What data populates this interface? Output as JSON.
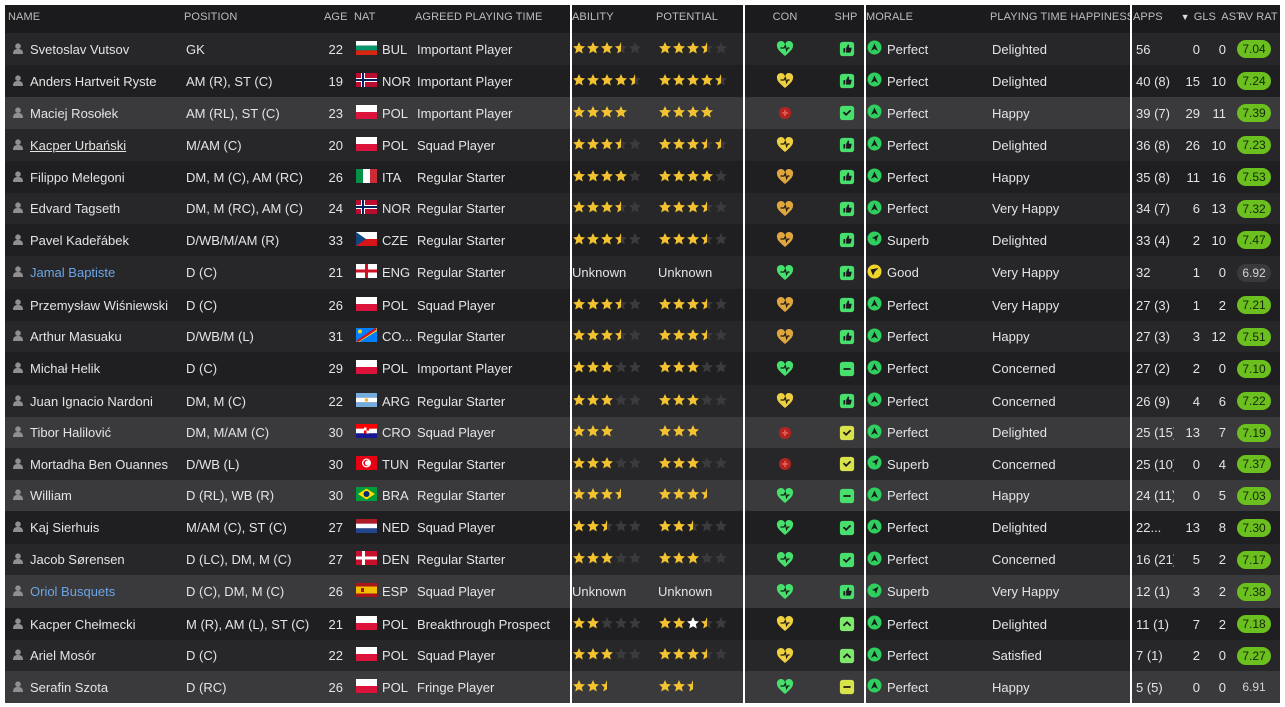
{
  "headers": {
    "name": "NAME",
    "position": "POSITION",
    "age": "AGE",
    "nat": "NAT",
    "playing_time": "AGREED PLAYING TIME",
    "ability": "ABILITY",
    "potential": "POTENTIAL",
    "con": "CON",
    "shp": "SHP",
    "morale": "MORALE",
    "happiness": "PLAYING TIME HAPPINESS",
    "apps": "APPS",
    "gls": "GLS",
    "ast": "AST",
    "avrat": "AV RAT"
  },
  "sort": {
    "column": "apps",
    "direction": "descending",
    "icon": "triangle-down-icon"
  },
  "colors": {
    "background": "#1b1b1d",
    "row_alt": "#27272a",
    "row_selected": "#3a3a3d",
    "star": "#f2c230",
    "heart_green": "#4be070",
    "heart_yellow": "#f2c744",
    "rating_good": "#6bbf1e",
    "morale_green": "#2ecf5d",
    "morale_yellow": "#f0d528",
    "link_blue": "#6aa6e6"
  },
  "players": [
    {
      "name": "Svetoslav Vutsov",
      "position": "GK",
      "age": "22",
      "nat": "BUL",
      "flag": "BUL",
      "playing_time": "Important Player",
      "ability": 3.5,
      "potential": 3.5,
      "ability_text": "",
      "potential_text": "",
      "con": "heart-green",
      "shp": "thumbs-up",
      "morale_icon": "up-green",
      "morale": "Perfect",
      "happiness": "Delighted",
      "apps": "56",
      "gls": "0",
      "ast": "0",
      "avrat": "7.04",
      "rat_class": "good",
      "name_style": "normal"
    },
    {
      "name": "Anders Hartveit Ryste",
      "position": "AM (R), ST (C)",
      "age": "19",
      "nat": "NOR",
      "flag": "NOR",
      "playing_time": "Important Player",
      "ability": 4.5,
      "potential": 4.5,
      "ability_text": "",
      "potential_text": "",
      "con": "heart-yellow",
      "shp": "thumbs-up",
      "morale_icon": "up-green",
      "morale": "Perfect",
      "happiness": "Delighted",
      "apps": "40 (8)",
      "gls": "15",
      "ast": "10",
      "avrat": "7.24",
      "rat_class": "good",
      "name_style": "normal"
    },
    {
      "name": "Maciej Rosołek",
      "position": "AM (RL), ST (C)",
      "age": "23",
      "nat": "POL",
      "flag": "POL",
      "playing_time": "Important Player",
      "ability": 4,
      "potential": 4,
      "ability_text": "",
      "potential_text": "",
      "con": "injury-red",
      "shp": "check",
      "morale_icon": "up-green",
      "morale": "Perfect",
      "happiness": "Happy",
      "apps": "39 (7)",
      "gls": "29",
      "ast": "11",
      "avrat": "7.39",
      "rat_class": "good",
      "name_style": "normal"
    },
    {
      "name": "Kacper Urbański",
      "position": "M/AM (C)",
      "age": "20",
      "nat": "POL",
      "flag": "POL",
      "playing_time": "Squad Player",
      "ability": 3.5,
      "potential": 4.5,
      "ability_text": "",
      "potential_text": "",
      "con": "heart-yellow",
      "shp": "thumbs-up",
      "morale_icon": "up-green",
      "morale": "Perfect",
      "happiness": "Delighted",
      "apps": "36 (8)",
      "gls": "26",
      "ast": "10",
      "avrat": "7.23",
      "rat_class": "good",
      "name_style": "underline"
    },
    {
      "name": "Filippo Melegoni",
      "position": "DM, M (C), AM (RC)",
      "age": "26",
      "nat": "ITA",
      "flag": "ITA",
      "playing_time": "Regular Starter",
      "ability": 4,
      "potential": 4,
      "ability_text": "",
      "potential_text": "",
      "con": "heart-orange",
      "shp": "thumbs-up",
      "morale_icon": "up-green",
      "morale": "Perfect",
      "happiness": "Happy",
      "apps": "35 (8)",
      "gls": "11",
      "ast": "16",
      "avrat": "7.53",
      "rat_class": "good",
      "name_style": "normal"
    },
    {
      "name": "Edvard Tagseth",
      "position": "DM, M (RC), AM (C)",
      "age": "24",
      "nat": "NOR",
      "flag": "NOR",
      "playing_time": "Regular Starter",
      "ability": 3.5,
      "potential": 3.5,
      "ability_text": "",
      "potential_text": "",
      "con": "heart-orange",
      "shp": "thumbs-up",
      "morale_icon": "up-green",
      "morale": "Perfect",
      "happiness": "Very Happy",
      "apps": "34 (7)",
      "gls": "6",
      "ast": "13",
      "avrat": "7.32",
      "rat_class": "good",
      "name_style": "normal"
    },
    {
      "name": "Pavel Kadeřábek",
      "position": "D/WB/M/AM (R)",
      "age": "33",
      "nat": "CZE",
      "flag": "CZE",
      "playing_time": "Regular Starter",
      "ability": 3.5,
      "potential": 3.5,
      "ability_text": "",
      "potential_text": "",
      "con": "heart-orange",
      "shp": "thumbs-up",
      "morale_icon": "diag-green",
      "morale": "Superb",
      "happiness": "Delighted",
      "apps": "33 (4)",
      "gls": "2",
      "ast": "10",
      "avrat": "7.47",
      "rat_class": "good",
      "name_style": "normal"
    },
    {
      "name": "Jamal Baptiste",
      "position": "D (C)",
      "age": "21",
      "nat": "ENG",
      "flag": "ENG",
      "playing_time": "Regular Starter",
      "ability": 0,
      "potential": 0,
      "ability_text": "Unknown",
      "potential_text": "Unknown",
      "con": "heart-green",
      "shp": "thumbs-up",
      "morale_icon": "diag-yellow",
      "morale": "Good",
      "happiness": "Very Happy",
      "apps": "32",
      "gls": "1",
      "ast": "0",
      "avrat": "6.92",
      "rat_class": "avg",
      "name_style": "link"
    },
    {
      "name": "Przemysław Wiśniewski",
      "position": "D (C)",
      "age": "26",
      "nat": "POL",
      "flag": "POL",
      "playing_time": "Squad Player",
      "ability": 3.5,
      "potential": 3.5,
      "ability_text": "",
      "potential_text": "",
      "con": "heart-orange",
      "shp": "thumbs-up",
      "morale_icon": "up-green",
      "morale": "Perfect",
      "happiness": "Very Happy",
      "apps": "27 (3)",
      "gls": "1",
      "ast": "2",
      "avrat": "7.21",
      "rat_class": "good",
      "name_style": "normal"
    },
    {
      "name": "Arthur Masuaku",
      "position": "D/WB/M (L)",
      "age": "31",
      "nat": "CO...",
      "flag": "COD",
      "playing_time": "Regular Starter",
      "ability": 3.5,
      "potential": 3.5,
      "ability_text": "",
      "potential_text": "",
      "con": "heart-orange",
      "shp": "thumbs-up",
      "morale_icon": "up-green",
      "morale": "Perfect",
      "happiness": "Happy",
      "apps": "27 (3)",
      "gls": "3",
      "ast": "12",
      "avrat": "7.51",
      "rat_class": "good",
      "name_style": "normal"
    },
    {
      "name": "Michał Helik",
      "position": "D (C)",
      "age": "29",
      "nat": "POL",
      "flag": "POL",
      "playing_time": "Important Player",
      "ability": 3,
      "potential": 3,
      "ability_text": "",
      "potential_text": "",
      "con": "heart-green",
      "shp": "minus",
      "morale_icon": "up-green",
      "morale": "Perfect",
      "happiness": "Concerned",
      "apps": "27 (2)",
      "gls": "2",
      "ast": "0",
      "avrat": "7.10",
      "rat_class": "good",
      "name_style": "normal"
    },
    {
      "name": "Juan Ignacio Nardoni",
      "position": "DM, M (C)",
      "age": "22",
      "nat": "ARG",
      "flag": "ARG",
      "playing_time": "Regular Starter",
      "ability": 3,
      "potential": 3,
      "ability_text": "",
      "potential_text": "",
      "con": "heart-yellow",
      "shp": "thumbs-up",
      "morale_icon": "up-green",
      "morale": "Perfect",
      "happiness": "Concerned",
      "apps": "26 (9)",
      "gls": "4",
      "ast": "6",
      "avrat": "7.22",
      "rat_class": "good",
      "name_style": "normal"
    },
    {
      "name": "Tibor Halilović",
      "position": "DM, M/AM (C)",
      "age": "30",
      "nat": "CRO",
      "flag": "CRO",
      "playing_time": "Squad Player",
      "ability": 3,
      "potential": 3,
      "ability_text": "",
      "potential_text": "",
      "con": "injury-red",
      "shp": "check-yellow",
      "morale_icon": "up-green",
      "morale": "Perfect",
      "happiness": "Delighted",
      "apps": "25 (15)",
      "gls": "13",
      "ast": "7",
      "avrat": "7.19",
      "rat_class": "good",
      "name_style": "normal"
    },
    {
      "name": "Mortadha Ben Ouannes",
      "position": "D/WB (L)",
      "age": "30",
      "nat": "TUN",
      "flag": "TUN",
      "playing_time": "Regular Starter",
      "ability": 3,
      "potential": 3,
      "ability_text": "",
      "potential_text": "",
      "con": "injury-red",
      "shp": "check-yellow",
      "morale_icon": "diag-green",
      "morale": "Superb",
      "happiness": "Concerned",
      "apps": "25 (10)",
      "gls": "0",
      "ast": "4",
      "avrat": "7.37",
      "rat_class": "good",
      "name_style": "normal"
    },
    {
      "name": "William",
      "position": "D (RL), WB (R)",
      "age": "30",
      "nat": "BRA",
      "flag": "BRA",
      "playing_time": "Regular Starter",
      "ability": 3.5,
      "potential": 3.5,
      "ability_text": "",
      "potential_text": "",
      "con": "heart-green",
      "shp": "minus",
      "morale_icon": "up-green",
      "morale": "Perfect",
      "happiness": "Happy",
      "apps": "24 (11)",
      "gls": "0",
      "ast": "5",
      "avrat": "7.03",
      "rat_class": "good",
      "name_style": "normal"
    },
    {
      "name": "Kaj Sierhuis",
      "position": "M/AM (C), ST (C)",
      "age": "27",
      "nat": "NED",
      "flag": "NED",
      "playing_time": "Squad Player",
      "ability": 2.5,
      "potential": 3,
      "ability_text": "",
      "potential_text": "",
      "con": "heart-green",
      "shp": "check",
      "morale_icon": "up-green",
      "morale": "Perfect",
      "happiness": "Delighted",
      "apps": "22...",
      "gls": "13",
      "ast": "8",
      "avrat": "7.30",
      "rat_class": "good",
      "name_style": "normal"
    },
    {
      "name": "Jacob Sørensen",
      "position": "D (LC), DM, M (C)",
      "age": "27",
      "nat": "DEN",
      "flag": "DEN",
      "playing_time": "Regular Starter",
      "ability": 3,
      "potential": 3,
      "ability_text": "",
      "potential_text": "",
      "con": "heart-green",
      "shp": "check",
      "morale_icon": "up-green",
      "morale": "Perfect",
      "happiness": "Concerned",
      "apps": "16 (21)",
      "gls": "5",
      "ast": "2",
      "avrat": "7.17",
      "rat_class": "good",
      "name_style": "normal"
    },
    {
      "name": "Oriol Busquets",
      "position": "D (C), DM, M (C)",
      "age": "26",
      "nat": "ESP",
      "flag": "ESP",
      "playing_time": "Squad Player",
      "ability": 0,
      "potential": 0,
      "ability_text": "Unknown",
      "potential_text": "Unknown",
      "con": "heart-green",
      "shp": "thumbs-up",
      "morale_icon": "diag-green",
      "morale": "Superb",
      "happiness": "Very Happy",
      "apps": "12 (1)",
      "gls": "3",
      "ast": "2",
      "avrat": "7.38",
      "rat_class": "good",
      "name_style": "link"
    },
    {
      "name": "Kacper Chełmecki",
      "position": "M (R), AM (L), ST (C)",
      "age": "21",
      "nat": "POL",
      "flag": "POL",
      "playing_time": "Breakthrough Prospect",
      "ability": 2,
      "potential": 3.5,
      "ability_text": "",
      "potential_text": "",
      "con": "heart-yellow",
      "shp": "up-arrow",
      "morale_icon": "up-green",
      "morale": "Perfect",
      "happiness": "Delighted",
      "apps": "11 (1)",
      "gls": "7",
      "ast": "2",
      "avrat": "7.18",
      "rat_class": "good",
      "name_style": "normal"
    },
    {
      "name": "Ariel Mosór",
      "position": "D (C)",
      "age": "22",
      "nat": "POL",
      "flag": "POL",
      "playing_time": "Squad Player",
      "ability": 3,
      "potential": 3.5,
      "ability_text": "",
      "potential_text": "",
      "con": "heart-yellow",
      "shp": "up-arrow",
      "morale_icon": "up-green",
      "morale": "Perfect",
      "happiness": "Satisfied",
      "apps": "7 (1)",
      "gls": "2",
      "ast": "0",
      "avrat": "7.27",
      "rat_class": "good",
      "name_style": "normal"
    },
    {
      "name": "Serafin Szota",
      "position": "D (RC)",
      "age": "26",
      "nat": "POL",
      "flag": "POL",
      "playing_time": "Fringe Player",
      "ability": 2.5,
      "potential": 2.5,
      "ability_text": "",
      "potential_text": "",
      "con": "heart-green",
      "shp": "minus-yellow",
      "morale_icon": "up-green",
      "morale": "Perfect",
      "happiness": "Happy",
      "apps": "5 (5)",
      "gls": "0",
      "ast": "0",
      "avrat": "6.91",
      "rat_class": "avg",
      "name_style": "normal"
    }
  ]
}
